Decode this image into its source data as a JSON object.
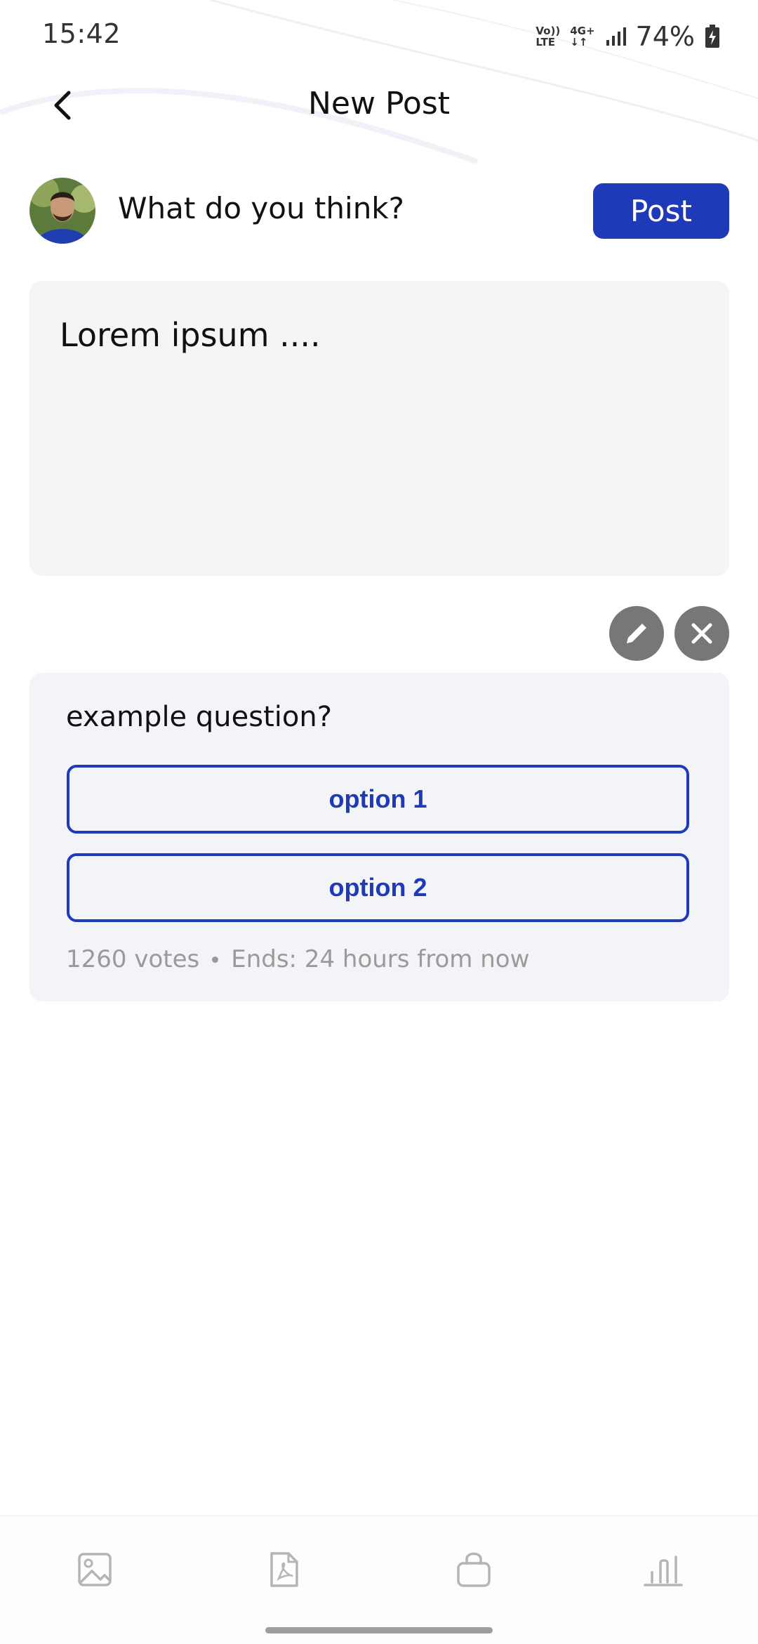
{
  "status_bar": {
    "time": "15:42",
    "volte_top": "Vo))",
    "volte_bottom": "LTE",
    "net_top": "4G+",
    "net_bottom": "↓↑",
    "battery": "74%"
  },
  "header": {
    "title": "New Post",
    "back_icon": "chevron-left-icon"
  },
  "composer": {
    "prompt": "What do you think?",
    "post_label": "Post",
    "text_value": "Lorem ipsum ...."
  },
  "poll": {
    "question": "example question?",
    "options": [
      "option 1",
      "option 2"
    ],
    "votes": "1260 votes",
    "ends": "Ends: 24 hours from now"
  },
  "toolbar": {
    "items": [
      "image-icon",
      "pdf-icon",
      "shopping-bag-icon",
      "poll-icon"
    ]
  },
  "colors": {
    "accent": "#1f3ab8",
    "input_bg": "#f5f5f6",
    "poll_bg": "#f3f4f8",
    "muted_text": "#9a9a9a",
    "action_circle": "#777777"
  }
}
